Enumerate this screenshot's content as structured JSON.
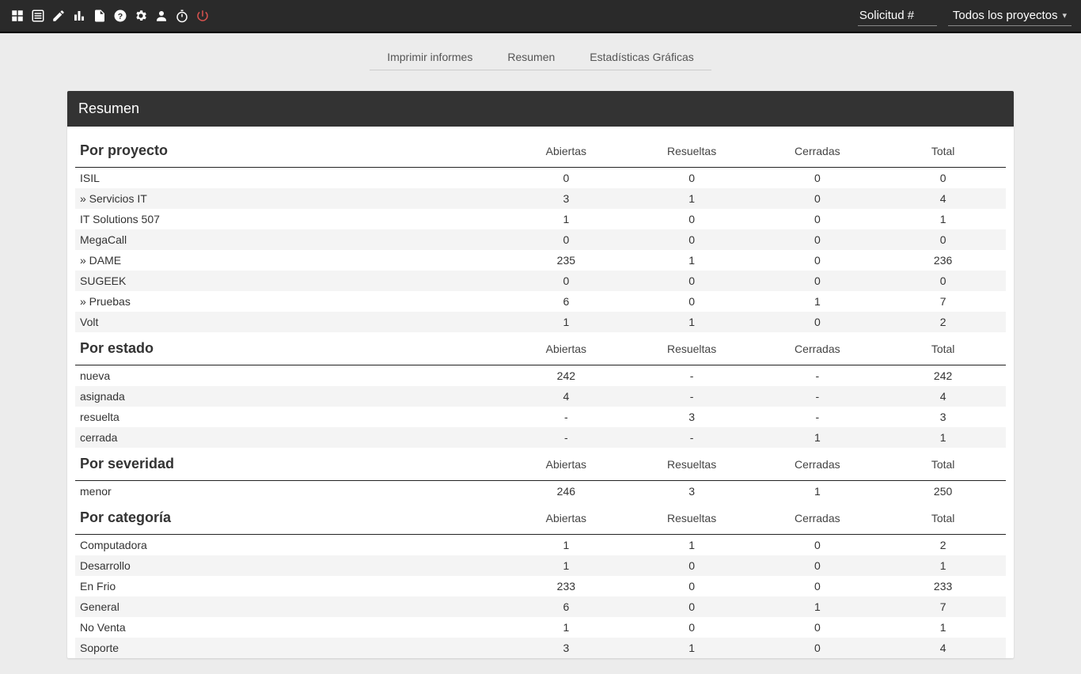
{
  "topbar": {
    "search_placeholder": "Solicitud #",
    "project_selector": "Todos los proyectos"
  },
  "tabs": {
    "print": "Imprimir informes",
    "summary": "Resumen",
    "stats": "Estadísticas Gráficas"
  },
  "panel_title": "Resumen",
  "columns": {
    "abiertas": "Abiertas",
    "resueltas": "Resueltas",
    "cerradas": "Cerradas",
    "total": "Total"
  },
  "sections": [
    {
      "title": "Por proyecto",
      "rows": [
        {
          "name": "ISIL",
          "abiertas": "0",
          "resueltas": "0",
          "cerradas": "0",
          "total": "0"
        },
        {
          "name": "» Servicios IT",
          "abiertas": "3",
          "resueltas": "1",
          "cerradas": "0",
          "total": "4"
        },
        {
          "name": "IT Solutions 507",
          "abiertas": "1",
          "resueltas": "0",
          "cerradas": "0",
          "total": "1"
        },
        {
          "name": "MegaCall",
          "abiertas": "0",
          "resueltas": "0",
          "cerradas": "0",
          "total": "0"
        },
        {
          "name": "» DAME",
          "abiertas": "235",
          "resueltas": "1",
          "cerradas": "0",
          "total": "236"
        },
        {
          "name": "SUGEEK",
          "abiertas": "0",
          "resueltas": "0",
          "cerradas": "0",
          "total": "0"
        },
        {
          "name": "» Pruebas",
          "abiertas": "6",
          "resueltas": "0",
          "cerradas": "1",
          "total": "7"
        },
        {
          "name": "Volt",
          "abiertas": "1",
          "resueltas": "1",
          "cerradas": "0",
          "total": "2"
        }
      ]
    },
    {
      "title": "Por estado",
      "rows": [
        {
          "name": "nueva",
          "abiertas": "242",
          "resueltas": "-",
          "cerradas": "-",
          "total": "242"
        },
        {
          "name": "asignada",
          "abiertas": "4",
          "resueltas": "-",
          "cerradas": "-",
          "total": "4"
        },
        {
          "name": "resuelta",
          "abiertas": "-",
          "resueltas": "3",
          "cerradas": "-",
          "total": "3"
        },
        {
          "name": "cerrada",
          "abiertas": "-",
          "resueltas": "-",
          "cerradas": "1",
          "total": "1"
        }
      ]
    },
    {
      "title": "Por severidad",
      "rows": [
        {
          "name": "menor",
          "abiertas": "246",
          "resueltas": "3",
          "cerradas": "1",
          "total": "250"
        }
      ]
    },
    {
      "title": "Por categoría",
      "rows": [
        {
          "name": "Computadora",
          "abiertas": "1",
          "resueltas": "1",
          "cerradas": "0",
          "total": "2"
        },
        {
          "name": "Desarrollo",
          "abiertas": "1",
          "resueltas": "0",
          "cerradas": "0",
          "total": "1"
        },
        {
          "name": "En Frio",
          "abiertas": "233",
          "resueltas": "0",
          "cerradas": "0",
          "total": "233"
        },
        {
          "name": "General",
          "abiertas": "6",
          "resueltas": "0",
          "cerradas": "1",
          "total": "7"
        },
        {
          "name": "No Venta",
          "abiertas": "1",
          "resueltas": "0",
          "cerradas": "0",
          "total": "1"
        },
        {
          "name": "Soporte",
          "abiertas": "3",
          "resueltas": "1",
          "cerradas": "0",
          "total": "4"
        }
      ]
    }
  ]
}
